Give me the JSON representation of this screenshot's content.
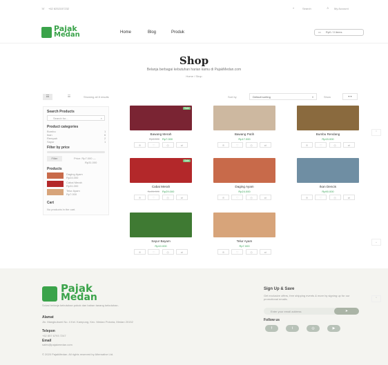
{
  "topbar": {
    "phone": "+62 8252157232",
    "search_label": "Search",
    "account_label": "My Account",
    "cart_label": "Rp0 / 0 items"
  },
  "brand": {
    "name_line1": "Pajak",
    "name_line2": "Medan",
    "color": "#3aa34a"
  },
  "nav": {
    "items": [
      "Home",
      "Blog",
      "Produk"
    ]
  },
  "page": {
    "title": "Shop",
    "subtitle": "Belanja berbagai kebutuhan harian kamu di PajakMedan.com",
    "breadcrumb": "Home  /  Shop"
  },
  "toolbar": {
    "results": "Showing all 8 results",
    "sort_label": "Sort by",
    "sort_value": "Default sorting",
    "show_label": "Show"
  },
  "sidebar": {
    "search_heading": "Search Products",
    "search_placeholder": "Search for...",
    "categories_heading": "Product categories",
    "categories": [
      {
        "name": "Bumbu",
        "count": "1"
      },
      {
        "name": "Ikan",
        "count": "6"
      },
      {
        "name": "Rempah",
        "count": "2"
      },
      {
        "name": "Sayur",
        "count": "1"
      }
    ],
    "filter_heading": "Filter by price",
    "filter_button": "Filter",
    "price_range": "Price: Rp7.000 —",
    "price_range_max": "Rp31.000",
    "products_heading": "Products",
    "products": [
      {
        "name": "Daging Ayam",
        "price": "Rp24.000"
      },
      {
        "name": "Cabai Merah",
        "price": "Rp31.000"
      },
      {
        "name": "Telur Ayam",
        "price": "Rp7.000"
      }
    ],
    "cart_heading": "Cart",
    "cart_empty": "No products in the cart."
  },
  "products": [
    {
      "name": "Bawang Merah",
      "price": "Rp7.000",
      "old_price": "Rp9.000",
      "sale": true,
      "color": "#7a2433"
    },
    {
      "name": "Bawang Putih",
      "price": "Rp17.000",
      "old_price": "",
      "sale": false,
      "color": "#cdb8a0"
    },
    {
      "name": "Bumbu Rendang",
      "price": "Rp15.000",
      "old_price": "",
      "sale": false,
      "color": "#8a6a3e"
    },
    {
      "name": "Cabai Merah",
      "price": "Rp29.000",
      "old_price": "Rp31.000",
      "sale": true,
      "color": "#b3282a"
    },
    {
      "name": "Daging Ayam",
      "price": "Rp24.000",
      "old_price": "",
      "sale": false,
      "color": "#c86a4a"
    },
    {
      "name": "Ikan Dencis",
      "price": "Rp90.000",
      "old_price": "",
      "sale": false,
      "color": "#6f8ea3"
    },
    {
      "name": "Sayur Bayam",
      "price": "Rp10.000",
      "old_price": "",
      "sale": false,
      "color": "#3f7a33"
    },
    {
      "name": "Telur Ayam",
      "price": "Rp7.000",
      "old_price": "",
      "sale": false,
      "color": "#d7a47a"
    }
  ],
  "sale_badge": "Sale",
  "footer": {
    "about": "Solusi belanja kebutuhan pokok dan bahan tanang kebutuhan.",
    "address_heading": "Alamat",
    "address": "Jln. Mangkubumi No. 4 Kel. Kampung, Kec. Medan Polonia, Medan 20152",
    "phone_heading": "Telepon",
    "phone": "+62 857 6793 7247",
    "email_heading": "Email",
    "email": "sales@pajakmedan.com",
    "copyright": "© 2020 PajakMedan. All rights reserved by Alternative Ltd.",
    "signup_heading": "Sign Up & Save",
    "signup_text": "Get exclusive offers, free shipping events & more by signing up for our promotional emails.",
    "email_placeholder": "Enter your email address",
    "follow_heading": "Follow us",
    "socials": [
      "f",
      "t",
      "ig",
      "yt"
    ]
  }
}
